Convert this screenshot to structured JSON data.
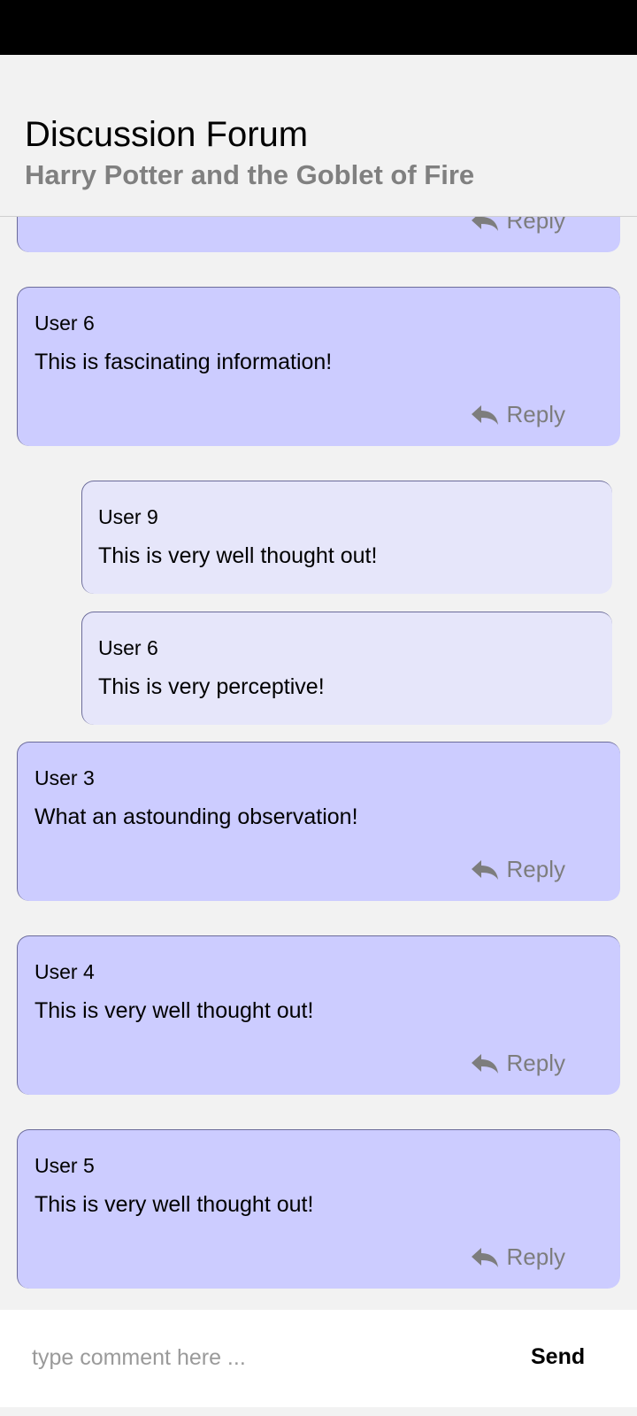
{
  "header": {
    "title": "Discussion Forum",
    "subtitle": "Harry Potter and the Goblet of Fire"
  },
  "comments": [
    {
      "user": "",
      "text": "",
      "reply_label": "Reply"
    },
    {
      "user": "User 6",
      "text": "This is fascinating information!",
      "reply_label": "Reply"
    },
    {
      "user": "User 9",
      "text": "This is very well thought out!"
    },
    {
      "user": "User 6",
      "text": "This is very perceptive!"
    },
    {
      "user": "User 3",
      "text": "What an astounding observation!",
      "reply_label": "Reply"
    },
    {
      "user": "User 4",
      "text": "This is very well thought out!",
      "reply_label": "Reply"
    },
    {
      "user": "User 5",
      "text": "This is very well thought out!",
      "reply_label": "Reply"
    }
  ],
  "footer": {
    "placeholder": "type comment here ...",
    "send_label": "Send"
  },
  "colors": {
    "main_card": "#ccccff",
    "reply_card": "#e6e6fa",
    "muted_text": "#808080",
    "background": "#f2f2f2"
  },
  "icons": {
    "reply": "reply-arrow-icon"
  }
}
